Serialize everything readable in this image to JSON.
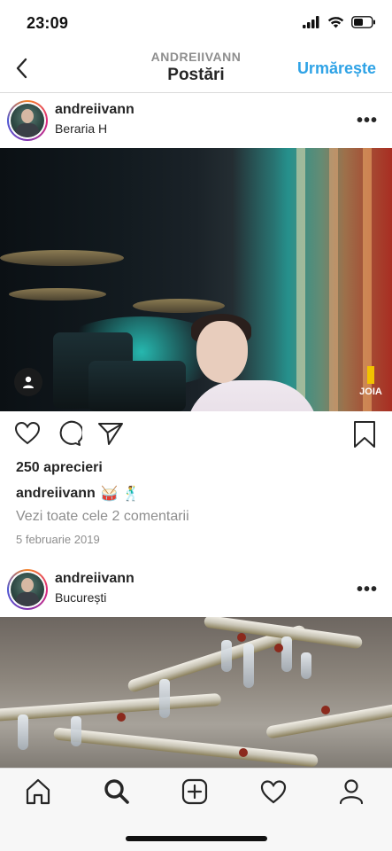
{
  "status_bar": {
    "time": "23:09",
    "icons": [
      "signal-icon",
      "wifi-icon",
      "battery-icon"
    ]
  },
  "header": {
    "back_icon": "chevron-left-icon",
    "username_caps": "ANDREIIVANN",
    "title": "Postări",
    "follow_label": "Urmărește"
  },
  "posts": [
    {
      "username": "andreiivann",
      "location": "Beraria H",
      "more_label": "•••",
      "likes": "250 aprecieri",
      "caption_user": "andreiivann",
      "caption_emoji": "🥁 🕺",
      "view_comments": "Vezi toate cele 2 comentarii",
      "date": "5 februarie 2019",
      "photo_logo": "JOIA"
    },
    {
      "username": "andreiivann",
      "location": "București",
      "more_label": "•••"
    }
  ],
  "actions": [
    "heart-icon",
    "comment-icon",
    "share-icon",
    "bookmark-icon"
  ],
  "tabbar": [
    "home-icon",
    "search-icon",
    "add-post-icon",
    "activity-icon",
    "profile-icon"
  ],
  "colors": {
    "accent": "#2fa3e6",
    "text": "#262626",
    "muted": "#8e8e8e",
    "divider": "#dbdbdb"
  }
}
